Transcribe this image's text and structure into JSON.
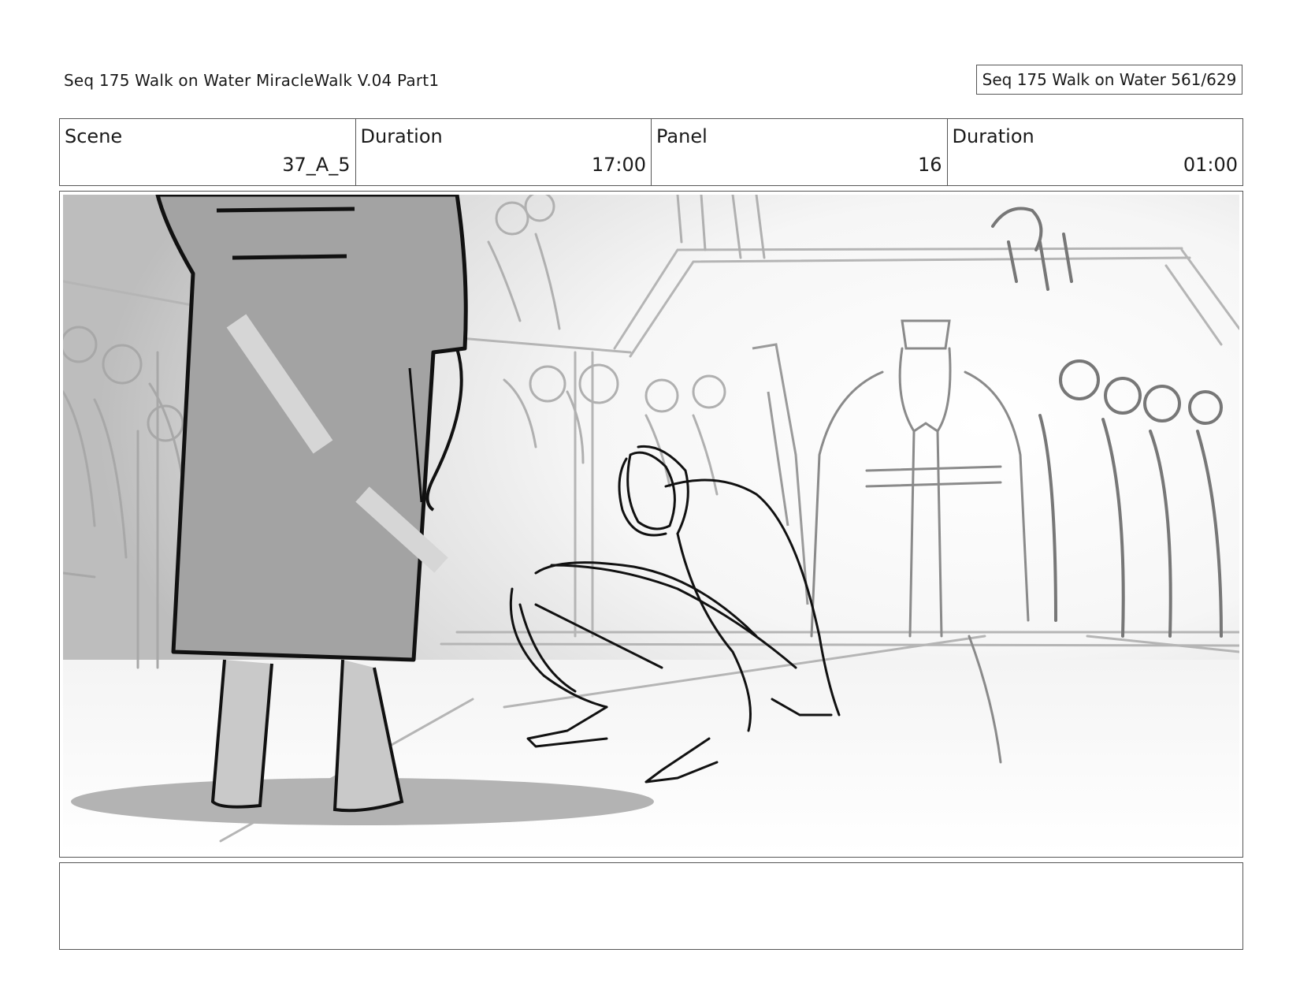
{
  "header": {
    "title": "Seq 175 Walk on Water  MiracleWalk V.04 Part1",
    "page_counter": "Seq 175 Walk on Water 561/629"
  },
  "info": {
    "scene_label": "Scene",
    "scene_value": "37_A_5",
    "duration_label": "Duration",
    "duration_value": "17:00",
    "panel_label": "Panel",
    "panel_value": "16",
    "panel_duration_label": "Duration",
    "panel_duration_value": "01:00"
  },
  "notes": {
    "text": ""
  }
}
